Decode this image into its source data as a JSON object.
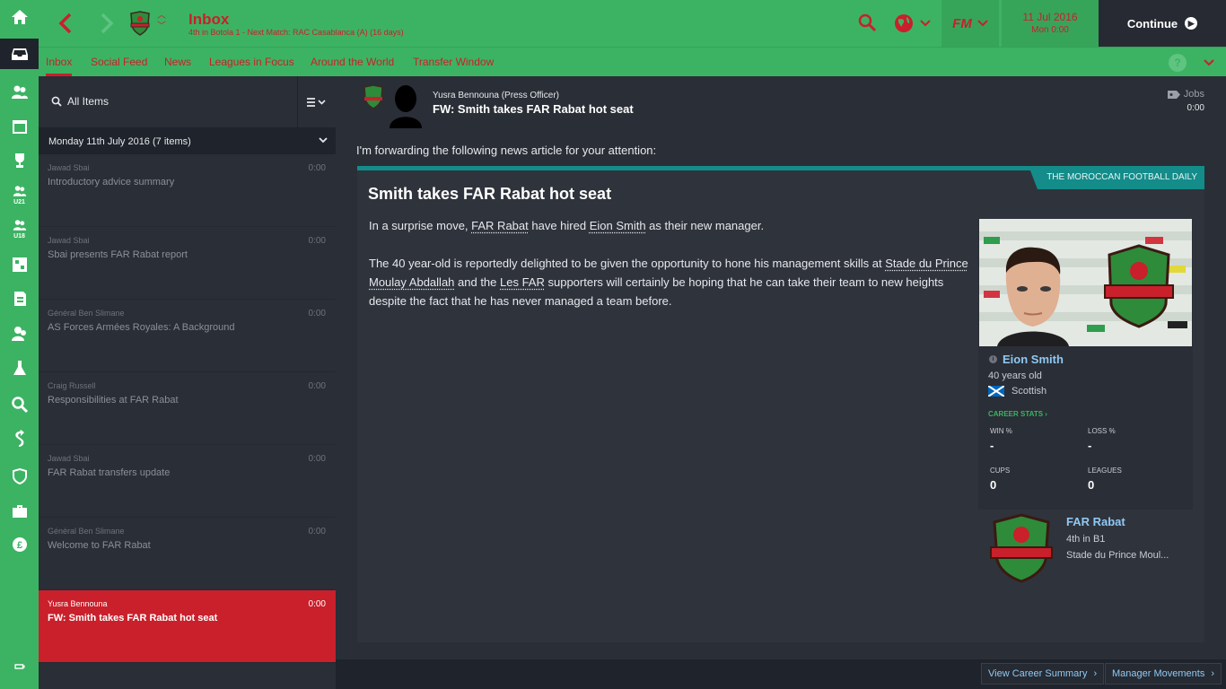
{
  "rail": {
    "items": [
      {
        "icon": "home-icon"
      },
      {
        "icon": "inbox-icon"
      },
      {
        "icon": "squad-icon"
      },
      {
        "icon": "calendar-icon"
      },
      {
        "icon": "trophy-icon"
      },
      {
        "icon": "u21-squad-icon",
        "sub": "U21"
      },
      {
        "icon": "u18-squad-icon",
        "sub": "U18"
      },
      {
        "icon": "tactics-icon"
      },
      {
        "icon": "scouting-report-icon"
      },
      {
        "icon": "staff-icon"
      },
      {
        "icon": "training-icon"
      },
      {
        "icon": "player-search-icon"
      },
      {
        "icon": "transfers-icon"
      },
      {
        "icon": "club-info-icon"
      },
      {
        "icon": "briefcase-icon"
      },
      {
        "icon": "finances-icon"
      },
      {
        "icon": "battery-icon"
      }
    ]
  },
  "header": {
    "title": "Inbox",
    "subtitle": "4th in Botola 1 - Next Match: RAC Casablanca (A) (16 days)",
    "date": "11 Jul 2016",
    "time": "Mon 0:00",
    "fm_logo": "FM",
    "continue_label": "Continue"
  },
  "tabs": [
    {
      "label": "Inbox",
      "active": true
    },
    {
      "label": "Social Feed",
      "active": false
    },
    {
      "label": "News",
      "active": false
    },
    {
      "label": "Leagues in Focus",
      "active": false
    },
    {
      "label": "Around the World",
      "active": false
    },
    {
      "label": "Transfer Window",
      "active": false
    }
  ],
  "help_label": "?",
  "inbox": {
    "filter_label": "All Items",
    "group_label": "Monday 11th July 2016 (7 items)",
    "messages": [
      {
        "from": "Jawad Sbai",
        "subject": "Introductory advice summary",
        "time": "0:00",
        "selected": false
      },
      {
        "from": "Jawad Sbai",
        "subject": "Sbai presents FAR Rabat report",
        "time": "0:00",
        "selected": false
      },
      {
        "from": "Général Ben Slimane",
        "subject": "AS Forces Armées Royales: A Background",
        "time": "0:00",
        "selected": false
      },
      {
        "from": "Craig Russell",
        "subject": "Responsibilities at FAR Rabat",
        "time": "0:00",
        "selected": false
      },
      {
        "from": "Jawad Sbai",
        "subject": "FAR Rabat transfers update",
        "time": "0:00",
        "selected": false
      },
      {
        "from": "Général Ben Slimane",
        "subject": "Welcome to FAR Rabat",
        "time": "0:00",
        "selected": false
      },
      {
        "from": "Yusra Bennouna",
        "subject": "FW: Smith takes FAR Rabat hot seat",
        "time": "0:00",
        "selected": true
      }
    ]
  },
  "message": {
    "sender": "Yusra Bennouna  (Press Officer)",
    "title": "FW: Smith takes FAR Rabat hot seat",
    "jobs_label": "Jobs",
    "time": "0:00",
    "intro": "I'm forwarding the following news article for your attention:"
  },
  "article": {
    "source": "THE MOROCCAN FOOTBALL DAILY",
    "title": "Smith takes FAR Rabat hot seat",
    "p1": {
      "t1": "In a surprise move, ",
      "club": "FAR Rabat",
      "t2": " have hired ",
      "person": "Eion Smith",
      "t3": " as their new manager."
    },
    "p2": {
      "t1": "The 40 year-old is reportedly delighted to be given the opportunity to hone his management skills at ",
      "stadium": "Stade du Prince Moulay Abdallah",
      "t2": " and the ",
      "fans": "Les FAR",
      "t3": " supporters will certainly be hoping that he can take their team to new heights despite the fact that he has never managed a team before."
    }
  },
  "card": {
    "info_label": "i",
    "name": "Eion Smith",
    "age": "40 years old",
    "nationality": "Scottish",
    "career_stats_label": "CAREER STATS",
    "stats": {
      "win_label": "WIN %",
      "win_value": "-",
      "loss_label": "LOSS %",
      "loss_value": "-",
      "cups_label": "CUPS",
      "cups_value": "0",
      "leagues_label": "LEAGUES",
      "leagues_value": "0"
    },
    "club": {
      "name": "FAR Rabat",
      "position": "4th in B1",
      "stadium": "Stade du Prince Moul..."
    }
  },
  "footer": {
    "view_career": "View Career Summary",
    "manager_movements": "Manager Movements"
  },
  "colors": {
    "accent_green": "#3cb363",
    "accent_red": "#c9202b",
    "teal": "#138c8a",
    "link_blue": "#8fc9f4",
    "background": "#1f232b"
  }
}
